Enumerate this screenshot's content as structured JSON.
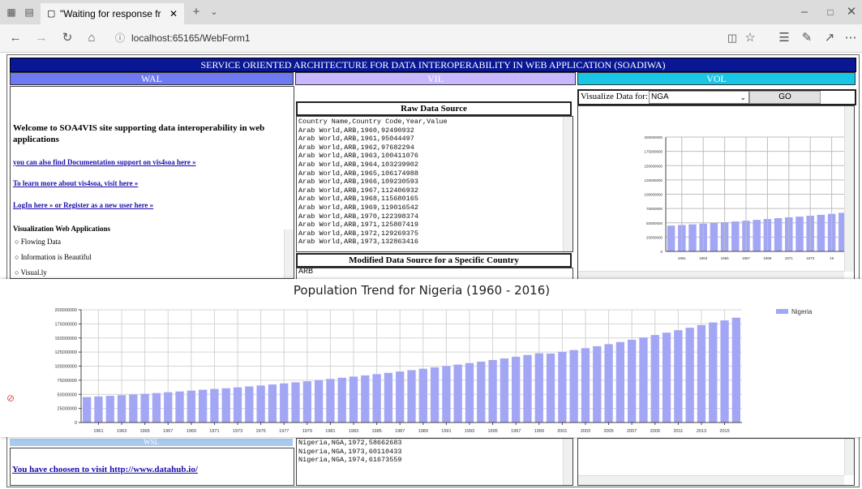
{
  "browser": {
    "tab_title": "\"Waiting for response fr",
    "url": "localhost:65165/WebForm1"
  },
  "page": {
    "banner": "SERVICE ORIENTED ARCHITECTURE FOR DATA INTEROPERABILITY IN WEB APPLICATION (SOADIWA)",
    "wal_header": "WAL",
    "vil_header": "VIL",
    "vol_header": "VOL",
    "wsl_header": "WSL",
    "welcome": "Welcome to SOA4VIS site supporting data interoperability in web applications",
    "link_docs": "you can also find Documentation support on vis4soa here »",
    "link_learn": "To learn more about vis4soa, visit here »",
    "link_login": "LogIn here » or Register as a new user here »",
    "apps_heading": "Visualization Web Applications",
    "apps": [
      "Flowing Data",
      "Information is Beautiful",
      "Visual.ly"
    ],
    "visit_text": "You have choosen to visit http://www.datahub.io/"
  },
  "raw_source": {
    "heading": "Raw Data Source",
    "lines": [
      "Country Name,Country Code,Year,Value",
      "Arab World,ARB,1960,92490932",
      "Arab World,ARB,1961,95044497",
      "Arab World,ARB,1962,97682294",
      "Arab World,ARB,1963,100411076",
      "Arab World,ARB,1964,103239902",
      "Arab World,ARB,1965,106174988",
      "Arab World,ARB,1966,109230593",
      "Arab World,ARB,1967,112406932",
      "Arab World,ARB,1968,115680165",
      "Arab World,ARB,1969,119016542",
      "Arab World,ARB,1970,122398374",
      "Arab World,ARB,1971,125807419",
      "Arab World,ARB,1972,129269375",
      "Arab World,ARB,1973,132863416"
    ]
  },
  "modified_source": {
    "heading": "Modified Data Source for a Specific Country",
    "top_line": "ARB",
    "lines": [
      "Nigeria,NGA,1972,58662683",
      "Nigeria,NGA,1973,60110433",
      "Nigeria,NGA,1974,61673559"
    ]
  },
  "visualize": {
    "label": "Visualize Data for:",
    "selected": "NGA",
    "go_label": "GO"
  },
  "small_chart": {
    "y_ticks": [
      "200000000",
      "175000000",
      "150000000",
      "125000000",
      "100000000",
      "75000000",
      "50000000",
      "25000000",
      "0"
    ],
    "x_ticks": [
      "1961",
      "1963",
      "1965",
      "1967",
      "1969",
      "1971",
      "1973",
      "19"
    ]
  },
  "colors": {
    "banner": "#0a1794",
    "wal_header": "#6f79f2",
    "vil_header": "#c7b8ff",
    "vol_header": "#19c6e6",
    "bar": "#a3a6f5"
  },
  "chart_data": {
    "type": "bar",
    "title": "Population Trend for Nigeria (1960 - 2016)",
    "legend": "Nigeria",
    "legend_position": "top-right",
    "grid": true,
    "ylim": [
      0,
      200000000
    ],
    "y_ticks": [
      "200000000",
      "175000000",
      "150000000",
      "125000000",
      "100000000",
      "75000000",
      "50000000",
      "25000000",
      "0"
    ],
    "x_tick_labels": [
      "1961",
      "1963",
      "1965",
      "1967",
      "1969",
      "1971",
      "1973",
      "1975",
      "1977",
      "1979",
      "1981",
      "1983",
      "1985",
      "1987",
      "1989",
      "1991",
      "1993",
      "1995",
      "1997",
      "1999",
      "2001",
      "2003",
      "2005",
      "2007",
      "2009",
      "2011",
      "2013",
      "2015"
    ],
    "categories": [
      1960,
      1961,
      1962,
      1963,
      1964,
      1965,
      1966,
      1967,
      1968,
      1969,
      1970,
      1971,
      1972,
      1973,
      1974,
      1975,
      1976,
      1977,
      1978,
      1979,
      1980,
      1981,
      1982,
      1983,
      1984,
      1985,
      1986,
      1987,
      1988,
      1989,
      1990,
      1991,
      1992,
      1993,
      1994,
      1995,
      1996,
      1997,
      1998,
      1999,
      2000,
      2001,
      2002,
      2003,
      2004,
      2005,
      2006,
      2007,
      2008,
      2009,
      2010,
      2011,
      2012,
      2013,
      2014,
      2015,
      2016
    ],
    "series": [
      {
        "name": "Nigeria",
        "values": [
          45100000,
          46200000,
          47300000,
          48500000,
          49800000,
          51000000,
          52300000,
          53700000,
          55100000,
          56600000,
          58100000,
          59600000,
          60800000,
          62400000,
          64000000,
          65700000,
          67500000,
          69400000,
          71300000,
          73200000,
          75200000,
          77300000,
          79400000,
          81500000,
          83600000,
          85800000,
          88100000,
          90500000,
          92900000,
          95400000,
          97800000,
          100300000,
          102800000,
          105400000,
          108000000,
          110800000,
          113700000,
          116700000,
          119800000,
          122900000,
          122350000,
          125460000,
          128600000,
          131900000,
          135400000,
          139000000,
          142800000,
          146800000,
          150900000,
          155200000,
          159400000,
          163800000,
          168200000,
          172800000,
          177500000,
          181200000,
          186000000
        ]
      }
    ]
  }
}
